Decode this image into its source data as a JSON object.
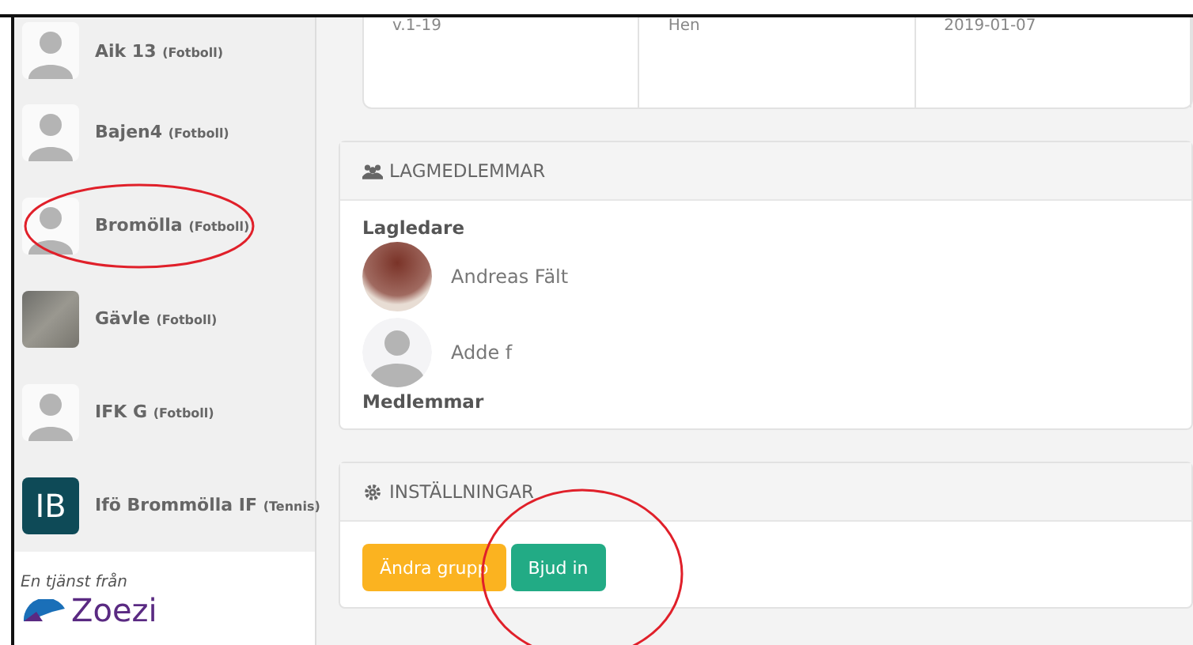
{
  "sidebar": {
    "items": [
      {
        "name": "Aik 13",
        "sport": "(Fotboll)",
        "kind": "silhouette",
        "circled": false
      },
      {
        "name": "Bajen4",
        "sport": "(Fotboll)",
        "kind": "silhouette",
        "circled": false
      },
      {
        "name": "Bromölla",
        "sport": "(Fotboll)",
        "kind": "silhouette",
        "circled": true
      },
      {
        "name": "Gävle",
        "sport": "(Fotboll)",
        "kind": "photo",
        "circled": false
      },
      {
        "name": "IFK G",
        "sport": "(Fotboll)",
        "kind": "silhouette",
        "circled": false
      },
      {
        "name": "Ifö Brommölla IF",
        "sport": "(Tennis)",
        "kind": "initials",
        "initials": "IB",
        "circled": false
      }
    ],
    "footer": {
      "caption": "En tjänst från",
      "logo": "Zoezi"
    }
  },
  "table_card": {
    "cells": [
      "v.1-19",
      "Hen",
      "2019-01-07"
    ]
  },
  "members": {
    "title": "LAGMEDLEMMAR",
    "leaders_heading": "Lagledare",
    "leaders": [
      {
        "name": "Andreas Fält",
        "kind": "photo"
      },
      {
        "name": "Adde f",
        "kind": "silhouette"
      }
    ],
    "members_heading": "Medlemmar"
  },
  "settings": {
    "title": "INSTÄLLNINGAR",
    "buttons": [
      {
        "label": "Ändra grupp",
        "kind": "warning",
        "circled": false
      },
      {
        "label": "Bjud in",
        "kind": "success",
        "circled": true
      }
    ]
  }
}
